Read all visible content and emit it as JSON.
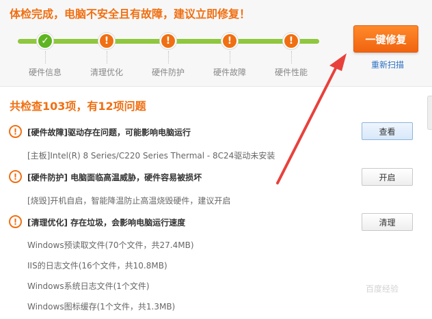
{
  "header": {
    "title": "体检完成，电脑不安全且有故障，建议立即修复！",
    "steps": [
      {
        "label": "硬件信息",
        "status": "ok",
        "icon": "check-icon"
      },
      {
        "label": "清理优化",
        "status": "warn",
        "icon": "exclamation-icon"
      },
      {
        "label": "硬件防护",
        "status": "warn",
        "icon": "exclamation-icon"
      },
      {
        "label": "硬件故障",
        "status": "warn",
        "icon": "exclamation-icon"
      },
      {
        "label": "硬件性能",
        "status": "warn",
        "icon": "exclamation-icon"
      }
    ],
    "fix_button": "一键修复",
    "rescan_link": "重新扫描"
  },
  "summary": "共检查103项，有12项问题",
  "issues": [
    {
      "title": "[硬件故障]驱动存在问题，可能影响电脑运行",
      "button": "查看",
      "details": [
        "[主板]Intel(R) 8 Series/C220 Series Thermal - 8C24驱动未安装"
      ]
    },
    {
      "title": "[硬件防护] 电脑面临高温威胁，硬件容易被损坏",
      "button": "开启",
      "details": [
        "[烧毁]开机自启，智能降温防止高温烧毁硬件，建议开启"
      ]
    },
    {
      "title": "[清理优化] 存在垃圾，会影响电脑运行速度",
      "button": "清理",
      "details": [
        "Windows预读取文件(70个文件，共27.4MB)",
        "IIS的日志文件(16个文件，共10.8MB)",
        "Windows系统日志文件(1个文件)",
        "Windows图标缓存(1个文件，共1.3MB)"
      ]
    }
  ],
  "watermark": "百度经验",
  "colors": {
    "accent_orange": "#f06f12",
    "ok_green": "#5fb520",
    "track_green": "#8fc73e",
    "link_blue": "#2b6fc2",
    "arrow_red": "#e8413c"
  }
}
